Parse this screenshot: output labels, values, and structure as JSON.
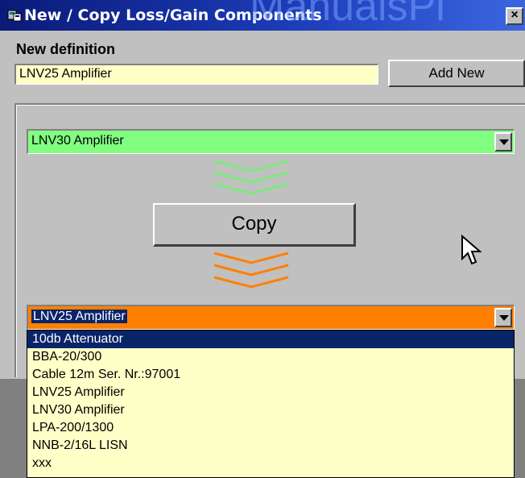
{
  "window": {
    "title": "New / Copy Loss/Gain Components",
    "watermark": "ManualsPl",
    "close_label": "×"
  },
  "new_definition": {
    "label": "New definition",
    "value": "LNV25 Amplifier",
    "add_button": "Add New"
  },
  "source_combo": {
    "value": "LNV30 Amplifier",
    "color": "#80ff80"
  },
  "copy_button": "Copy",
  "target_combo": {
    "value": "LNV25 Amplifier",
    "color": "#ff8000",
    "options": [
      "10db Attenuator",
      "BBA-20/300",
      "Cable 12m  Ser. Nr.:97001",
      "LNV25 Amplifier",
      "LNV30 Amplifier",
      "LPA-200/1300",
      "NNB-2/16L LISN",
      "xxx"
    ],
    "highlighted_index": 0
  },
  "colors": {
    "green_arrow": "#7ee87e",
    "orange_arrow": "#ff8000",
    "input_bg": "#ffffc8",
    "title_bar": "#0a246a"
  }
}
